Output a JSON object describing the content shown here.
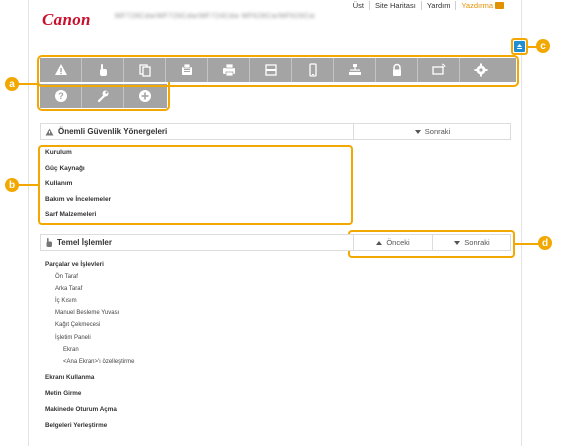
{
  "header": {
    "logo": "Canon",
    "model_text": "MF728Cdw/MF726Cdw/MF724Cdw MF628Cw/MF626Cw",
    "links": [
      "Üst",
      "Site Haritası",
      "Yardım"
    ],
    "print_label": "Yazdırma"
  },
  "toolbar": {
    "row1_icons": [
      "warning-icon",
      "hand-icon",
      "copy-icon",
      "fax-icon",
      "printer-icon",
      "scanner-icon",
      "mobile-icon",
      "network-icon",
      "lock-icon",
      "remote-ui-icon",
      "gear-icon"
    ],
    "row2_icons": [
      "help-icon",
      "wrench-icon",
      "plus-icon"
    ],
    "bar_color": "#a4a4a4"
  },
  "callouts": {
    "a": "a",
    "b": "b",
    "c": "c",
    "d": "d",
    "color": "#f2a800"
  },
  "section1": {
    "title": "Önemli Güvenlik Yönergeleri",
    "next": "Sonraki",
    "items": [
      "Kurulum",
      "Güç Kaynağı",
      "Kullanım",
      "Bakım ve İncelemeler",
      "Sarf Malzemeleri"
    ]
  },
  "section2": {
    "title": "Temel İşlemler",
    "prev": "Önceki",
    "next": "Sonraki",
    "items": [
      {
        "text": "Parçalar ve İşlevleri",
        "level": 0
      },
      {
        "text": "Ön Taraf",
        "level": 1
      },
      {
        "text": "Arka Taraf",
        "level": 1
      },
      {
        "text": "İç Kısım",
        "level": 1
      },
      {
        "text": "Manuel Besleme Yuvası",
        "level": 1
      },
      {
        "text": "Kağıt Çekmecesi",
        "level": 1
      },
      {
        "text": "İşletim Paneli",
        "level": 1
      },
      {
        "text": "Ekran",
        "level": 2
      },
      {
        "text": "<Ana Ekran>'ı özelleştirme",
        "level": 2
      },
      {
        "text": "Ekranı Kullanma",
        "level": 0
      },
      {
        "text": "Metin Girme",
        "level": 0
      },
      {
        "text": "Makinede Oturum Açma",
        "level": 0
      },
      {
        "text": "Belgeleri Yerleştirme",
        "level": 0
      }
    ]
  }
}
